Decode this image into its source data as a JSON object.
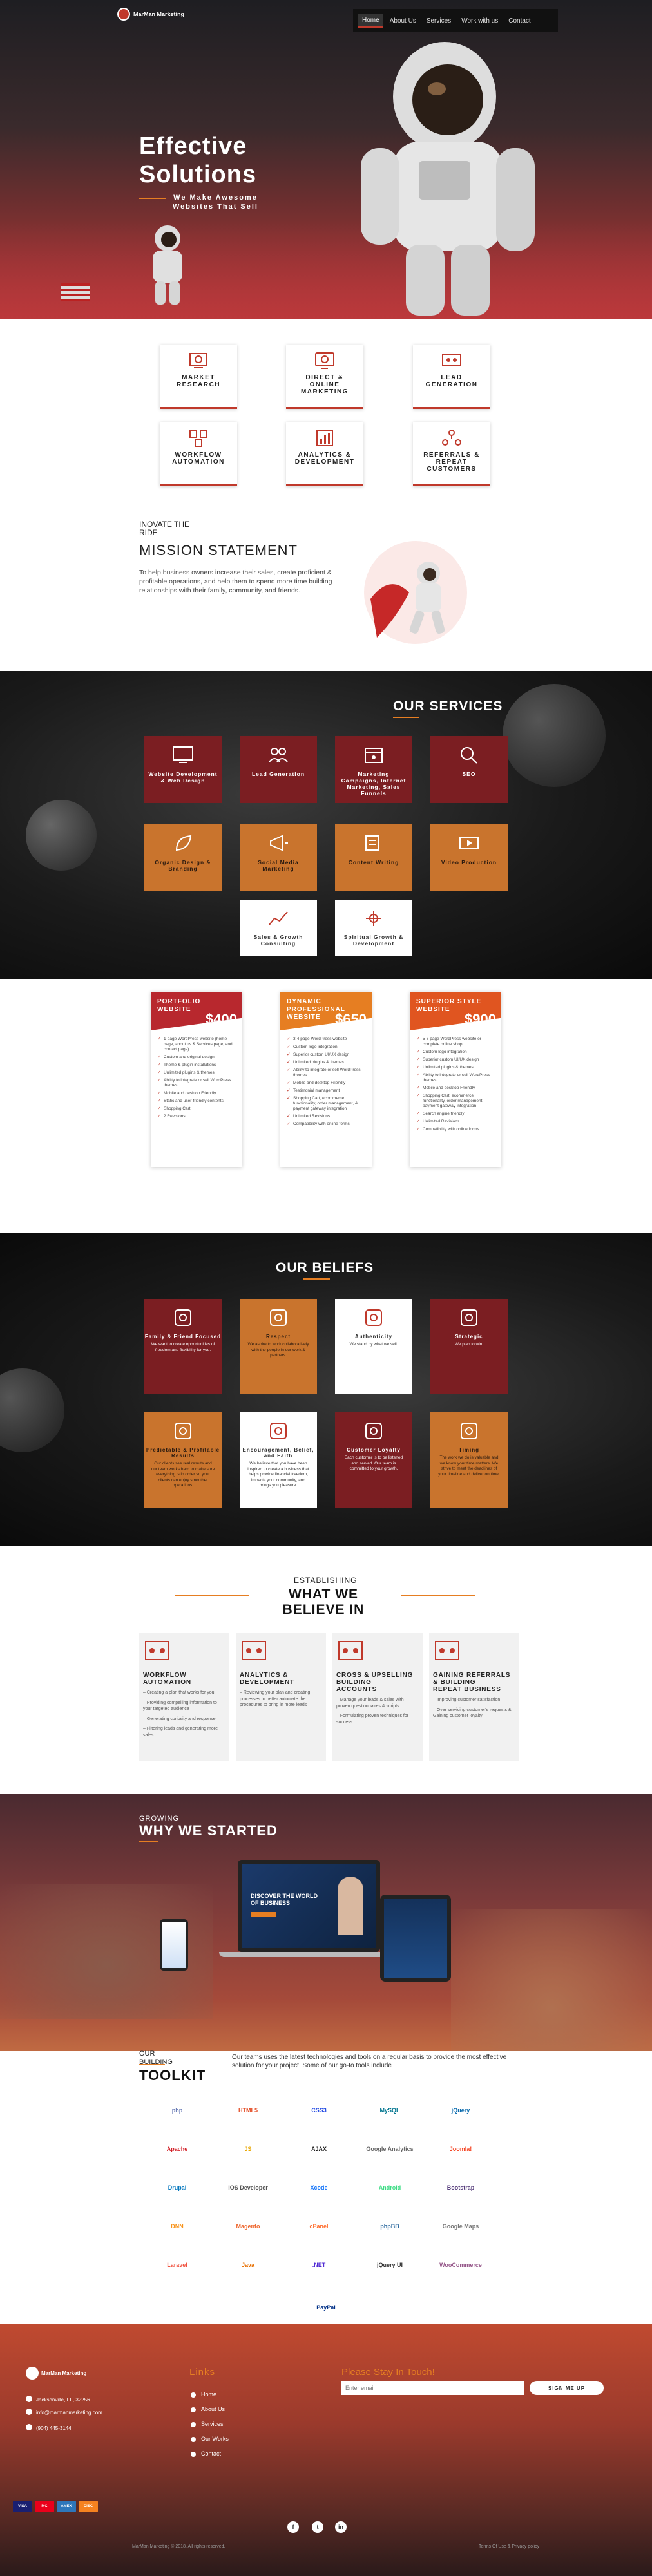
{
  "brand": {
    "name": "MarMan Marketing",
    "accent": "#c0392b",
    "secondary": "#e67e22"
  },
  "nav": {
    "items": [
      {
        "label": "Home",
        "active": true
      },
      {
        "label": "About Us"
      },
      {
        "label": "Services"
      },
      {
        "label": "Work with us"
      },
      {
        "label": "Contact"
      }
    ]
  },
  "hero": {
    "title_1": "Effective",
    "title_2": "Solutions",
    "subtitle_1": "We Make Awesome",
    "subtitle_2": "Websites That Sell"
  },
  "features": [
    {
      "l1": "MARKET",
      "l2": "RESEARCH",
      "icon": "research-icon"
    },
    {
      "l1": "DIRECT &",
      "l2": "ONLINE",
      "l3": "MARKETING",
      "icon": "online-marketing-icon"
    },
    {
      "l1": "LEAD",
      "l2": "GENERATION",
      "icon": "lead-generation-icon"
    },
    {
      "l1": "WORKFLOW",
      "l2": "AUTOMATION",
      "icon": "workflow-icon"
    },
    {
      "l1": "ANALYTICS &",
      "l2": "DEVELOPMENT",
      "icon": "analytics-icon"
    },
    {
      "l1": "REFERRALS &",
      "l2": "REPEAT",
      "l3": "CUSTOMERS",
      "icon": "referrals-icon"
    }
  ],
  "mission": {
    "kicker_1": "INOVATE THE",
    "kicker_2": "RIDE",
    "title": "MISSION STATEMENT",
    "text": "To help business owners increase their sales, create proficient & profitable operations, and help them to spend more time building relationships with their family, community, and friends."
  },
  "services": {
    "title": "OUR SERVICES",
    "items": [
      {
        "label": "Website Development & Web Design",
        "icon": "monitor-icon",
        "style": "red"
      },
      {
        "label": "Lead Generation",
        "icon": "users-icon",
        "style": "red"
      },
      {
        "label": "Marketing Campaigns, Internet Marketing, Sales Funnels",
        "icon": "calendar-icon",
        "style": "red"
      },
      {
        "label": "SEO",
        "icon": "seo-icon",
        "style": "red"
      },
      {
        "label": "Organic Design & Branding",
        "icon": "leaf-icon",
        "style": "orange"
      },
      {
        "label": "Social Media Marketing",
        "icon": "megaphone-icon",
        "style": "orange"
      },
      {
        "label": "Content Writing",
        "icon": "pen-icon",
        "style": "orange"
      },
      {
        "label": "Video Production",
        "icon": "video-icon",
        "style": "orange"
      },
      {
        "label": "Sales & Growth Consulting",
        "icon": "growth-icon",
        "style": "white"
      },
      {
        "label": "Spiritual Growth & Development",
        "icon": "spiritual-icon",
        "style": "white"
      }
    ]
  },
  "pricing": [
    {
      "title_1": "PORTFOLIO",
      "title_2": "WEBSITE",
      "price": "$400",
      "color": "#b8282e",
      "features": [
        "1-page WordPress website (home page, about us & Services page, and contact page)",
        "Custom and original design",
        "Theme & plugin installations",
        "Unlimited plugins & themes",
        "Ability to integrate or sell WordPress themes",
        "Mobile and desktop Friendly",
        "Static and user-friendly contents",
        "Shopping Cart",
        "2 Revisions"
      ]
    },
    {
      "title_1": "DYNAMIC",
      "title_2": "PROFESSIONAL",
      "title_3": "WEBSITE",
      "price": "$650",
      "color": "#e67e22",
      "features": [
        "3-4 page WordPress website",
        "Custom logo integration",
        "Superior custom UI/UX design",
        "Unlimited plugins & themes",
        "Ability to integrate or sell WordPress themes",
        "Mobile and desktop Friendly",
        "Testimonial management",
        "Shopping Cart, ecommerce functionality, order management, & payment gateway integration",
        "Unlimited Revisions",
        "Compatibility with online forms"
      ]
    },
    {
      "title_1": "SUPERIOR STYLE",
      "title_2": "WEBSITE",
      "price": "$900",
      "color": "#e05520",
      "features": [
        "5-6 page WordPress website or complete online shop",
        "Custom logo integration",
        "Superior custom UI/UX design",
        "Unlimited plugins & themes",
        "Ability to integrate or sell WordPress themes",
        "Mobile and desktop Friendly",
        "Shopping Cart, ecommerce functionality, order management, payment gateway integration",
        "Search engine friendly",
        "Unlimited Revisions",
        "Compatibility with online forms"
      ]
    }
  ],
  "beliefs": {
    "title": "OUR BELIEFS",
    "items": [
      {
        "title": "Family & Friend Focused",
        "text": "We want to create opportunities of freedom and flexibility for you.",
        "icon": "rocket-icon",
        "style": "red"
      },
      {
        "title": "Respect",
        "text": "We aspire to work collaboratively with the people in our work & partners.",
        "icon": "tools-icon",
        "style": "orange"
      },
      {
        "title": "Authenticity",
        "text": "We stand by what we sell.",
        "icon": "target-icon",
        "style": "white"
      },
      {
        "title": "Strategic",
        "text": "We plan to win.",
        "icon": "puzzle-icon",
        "style": "red"
      },
      {
        "title": "Predictable & Profitable Results",
        "text": "Our clients see real results and our team works hard to make sure everything is in order so your clients can enjoy smoother operations.",
        "icon": "chart-icon",
        "style": "orange"
      },
      {
        "title": "Encouragement, Belief, and Faith",
        "text": "We believe that you have been inspired to create a business that helps provide financial freedom, impacts your community, and brings you pleasure.",
        "icon": "diamond-icon",
        "style": "white"
      },
      {
        "title": "Customer Loyalty",
        "text": "Each customer is to be listened and served. Our team is committed to your growth.",
        "icon": "browser-icon",
        "style": "red"
      },
      {
        "title": "Timing",
        "text": "The work we do is valuable and we know your time matters. We strive to meet the deadlines of your timeline and deliver on time.",
        "icon": "clock-icon",
        "style": "orange"
      }
    ]
  },
  "establishing": {
    "kicker": "ESTABLISHING",
    "title_1": "WHAT WE",
    "title_2": "BELIEVE IN",
    "columns": [
      {
        "l1": "WORKFLOW",
        "l2": "AUTOMATION",
        "icon": "workflow-icon",
        "points": [
          "Creating a plan that works for you",
          "Providing compelling information to your targeted audience",
          "Generating curiosity and response",
          "Filtering leads and generating more sales"
        ]
      },
      {
        "l1": "ANALYTICS &",
        "l2": "DEVELOPMENT",
        "icon": "analytics-icon",
        "points": [
          "Reviewing your plan and creating processes to better automate the procedures to bring in more leads"
        ]
      },
      {
        "l1": "CROSS & UPSELLING",
        "l2": "BUILDING",
        "l3": "ACCOUNTS",
        "icon": "upsell-icon",
        "points": [
          "Manage your leads & sales with proven questionnaires & scripts",
          "Formulating proven techniques for success"
        ]
      },
      {
        "l1": "GAINING REFERRALS",
        "l2": "& BUILDING",
        "l3": "REPEAT BUSINESS",
        "icon": "referrals-icon",
        "points": [
          "Improving customer satisfaction",
          "Over servicing customer's requests & Gaining customer loyalty"
        ]
      }
    ]
  },
  "started": {
    "kicker": "GROWING",
    "title": "WHY WE STARTED",
    "screen_headline_1": "DISCOVER THE WORLD",
    "screen_headline_2": "OF BUSINESS"
  },
  "toolkit": {
    "kicker_1": "OUR",
    "kicker_2": "BUILDING",
    "title": "TOOLKIT",
    "text": "Our teams uses the latest technologies and tools on a regular basis to provide the most effective solution for your project. Some of our go-to tools include",
    "tools": [
      {
        "label": "php",
        "color": "#6c7eb7"
      },
      {
        "label": "HTML5",
        "color": "#e44d26"
      },
      {
        "label": "CSS3",
        "color": "#264de4"
      },
      {
        "label": "MySQL",
        "color": "#00758f"
      },
      {
        "label": "jQuery",
        "color": "#0769ad"
      },
      {
        "label": "Apache",
        "color": "#d22128"
      },
      {
        "label": "JS",
        "color": "#e8a600"
      },
      {
        "label": "AJAX",
        "color": "#222222"
      },
      {
        "label": "Google Analytics",
        "color": "#666666"
      },
      {
        "label": "Joomla!",
        "color": "#f44321"
      },
      {
        "label": "Drupal",
        "color": "#0678be"
      },
      {
        "label": "iOS Developer",
        "color": "#555555"
      },
      {
        "label": "Xcode",
        "color": "#1575f9"
      },
      {
        "label": "Android",
        "color": "#3ddc84"
      },
      {
        "label": "Bootstrap",
        "color": "#563d7c"
      },
      {
        "label": "DNN",
        "color": "#f7941d"
      },
      {
        "label": "Magento",
        "color": "#ee672f"
      },
      {
        "label": "cPanel",
        "color": "#ff6c2c"
      },
      {
        "label": "phpBB",
        "color": "#2d6a9f"
      },
      {
        "label": "Google Maps",
        "color": "#777777"
      },
      {
        "label": "Laravel",
        "color": "#f05340"
      },
      {
        "label": "Java",
        "color": "#e76f00"
      },
      {
        "label": ".NET",
        "color": "#512bd4"
      },
      {
        "label": "jQuery UI",
        "color": "#333333"
      },
      {
        "label": "WooCommerce",
        "color": "#96588a"
      },
      {
        "label": "PayPal",
        "color": "#003087"
      }
    ]
  },
  "footer": {
    "links_title": "Links",
    "links": [
      "Home",
      "About Us",
      "Services",
      "Our Works",
      "Contact"
    ],
    "news_title": "Please Stay In Touch!",
    "email_placeholder": "Enter email",
    "signup": "SIGN ME UP",
    "address": "Jacksonville, FL, 32256",
    "email": "info@marmanmarketing.com",
    "phone": "(904) 445-3144",
    "copyright": "MarMan Marketing © 2018. All rights reserved.",
    "terms": "Terms Of Use & Privacy policy",
    "social": [
      "f",
      "t",
      "in"
    ],
    "payments": [
      {
        "label": "VISA",
        "color": "#1a1f71"
      },
      {
        "label": "MC",
        "color": "#eb001b"
      },
      {
        "label": "AMEX",
        "color": "#2e77bb"
      },
      {
        "label": "DISC",
        "color": "#f58220"
      }
    ]
  }
}
